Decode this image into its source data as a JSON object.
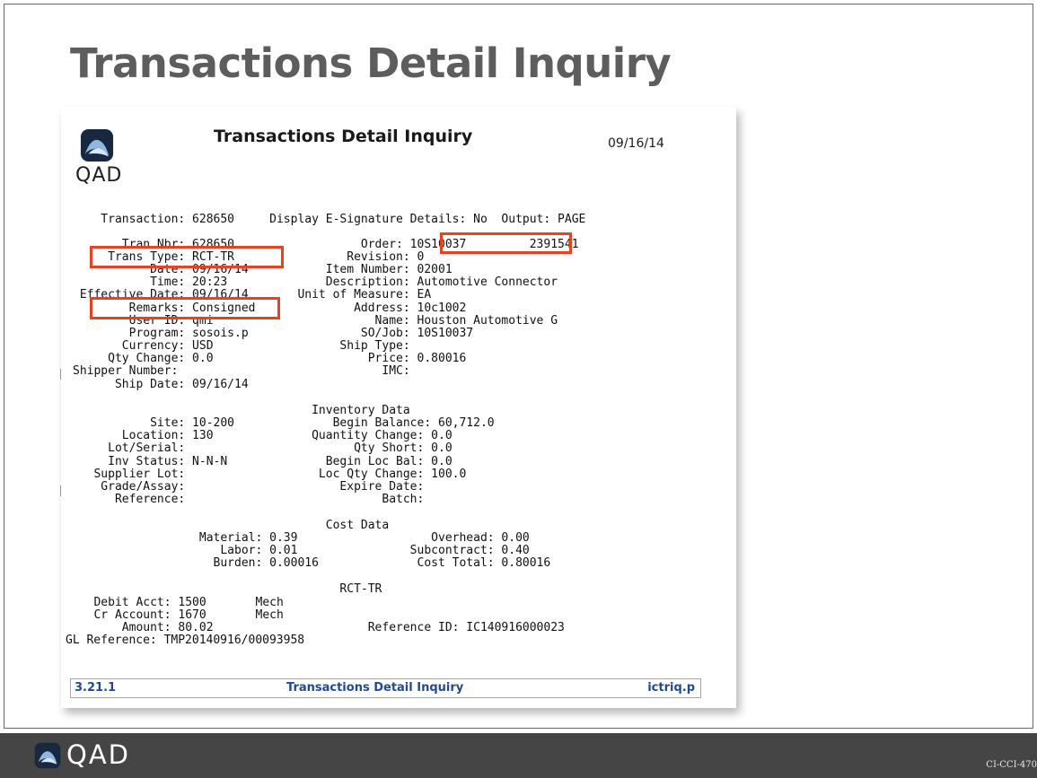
{
  "slide": {
    "title": "Transactions Detail Inquiry",
    "brand": "QAD",
    "slide_id": "CI-CCI-470"
  },
  "report": {
    "logo_text": "QAD",
    "heading": "Transactions Detail Inquiry",
    "date": "09/16/14",
    "lines": [
      "    Transaction: 628650     Display E-Signature Details: No  Output: PAGE",
      "       Tran Nbr: 628650                  Order: 10S10037         2391541",
      "     Trans Type: RCT-TR                Revision: 0",
      "           Date: 09/16/14           Item Number: 02001",
      "           Time: 20:23              Description: Automotive Connector",
      " Effective Date: 09/16/14       Unit of Measure: EA",
      "        Remarks: Consigned              Address: 10c1002",
      "        User ID: qmi                       Name: Houston Automotive G",
      "        Program: sosois.p                SO/Job: 10S10037",
      "       Currency: USD                  Ship Type:",
      "     Qty Change: 0.0                      Price: 0.80016",
      "Shipper Number:                             IMC:",
      "      Ship Date: 09/16/14",
      "                                  Inventory Data",
      "           Site: 10-200              Begin Balance: 60,712.0",
      "       Location: 130              Quantity Change: 0.0",
      "     Lot/Serial:                        Qty Short: 0.0",
      "     Inv Status: N-N-N              Begin Loc Bal: 0.0",
      "   Supplier Lot:                   Loc Qty Change: 100.0",
      "    Grade/Assay:                      Expire Date:",
      "      Reference:                            Batch:",
      "                                    Cost Data",
      "                  Material: 0.39                   Overhead: 0.00",
      "                     Labor: 0.01                Subcontract: 0.40",
      "                    Burden: 0.00016              Cost Total: 0.80016",
      "                                      RCT-TR",
      "   Debit Acct: 1500       Mech",
      "   Cr Account: 1670       Mech",
      "       Amount: 80.02                      Reference ID: IC140916000023",
      "GL Reference: TMP20140916/00093958"
    ],
    "footer": {
      "menu_number": "3.21.1",
      "program_title": "Transactions Detail Inquiry",
      "program_file": "ictriq.p"
    }
  },
  "colors": {
    "highlight": "#e8431d",
    "footer_bar": "#454545",
    "footer_link": "#1f4a93",
    "title": "#5d5d5d"
  }
}
